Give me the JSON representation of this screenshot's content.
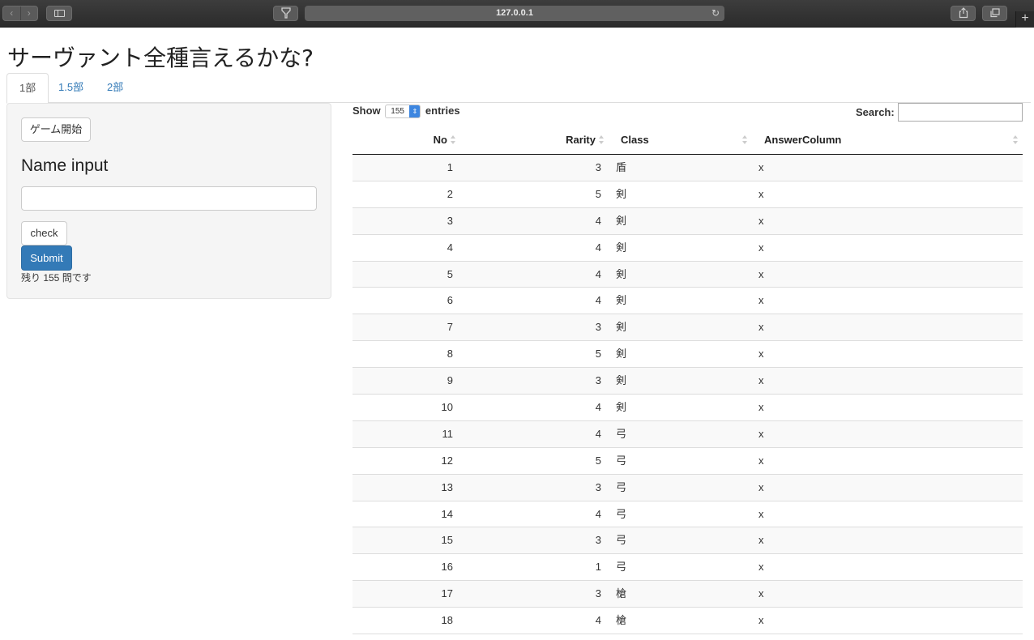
{
  "browser": {
    "url": "127.0.0.1",
    "new_tab": "+"
  },
  "page": {
    "title": "サーヴァント全種言えるかな?"
  },
  "tabs": [
    {
      "label": "1部"
    },
    {
      "label": "1.5部"
    },
    {
      "label": "2部"
    }
  ],
  "panel": {
    "start_label": "ゲーム開始",
    "name_label": "Name input",
    "name_value": "",
    "check_label": "check",
    "submit_label": "Submit",
    "remaining_text": "残り 155 問です"
  },
  "table": {
    "show_label": "Show",
    "entries_label": "entries",
    "page_length": "155",
    "search_label": "Search:",
    "search_value": "",
    "columns": [
      "No",
      "Rarity",
      "Class",
      "AnswerColumn"
    ],
    "rows": [
      [
        "1",
        "3",
        "盾",
        "x"
      ],
      [
        "2",
        "5",
        "剣",
        "x"
      ],
      [
        "3",
        "4",
        "剣",
        "x"
      ],
      [
        "4",
        "4",
        "剣",
        "x"
      ],
      [
        "5",
        "4",
        "剣",
        "x"
      ],
      [
        "6",
        "4",
        "剣",
        "x"
      ],
      [
        "7",
        "3",
        "剣",
        "x"
      ],
      [
        "8",
        "5",
        "剣",
        "x"
      ],
      [
        "9",
        "3",
        "剣",
        "x"
      ],
      [
        "10",
        "4",
        "剣",
        "x"
      ],
      [
        "11",
        "4",
        "弓",
        "x"
      ],
      [
        "12",
        "5",
        "弓",
        "x"
      ],
      [
        "13",
        "3",
        "弓",
        "x"
      ],
      [
        "14",
        "4",
        "弓",
        "x"
      ],
      [
        "15",
        "3",
        "弓",
        "x"
      ],
      [
        "16",
        "1",
        "弓",
        "x"
      ],
      [
        "17",
        "3",
        "槍",
        "x"
      ],
      [
        "18",
        "4",
        "槍",
        "x"
      ]
    ]
  },
  "colors": {
    "link": "#337ab7",
    "primary_button": "#337ab7",
    "well_background": "#f5f5f5"
  }
}
